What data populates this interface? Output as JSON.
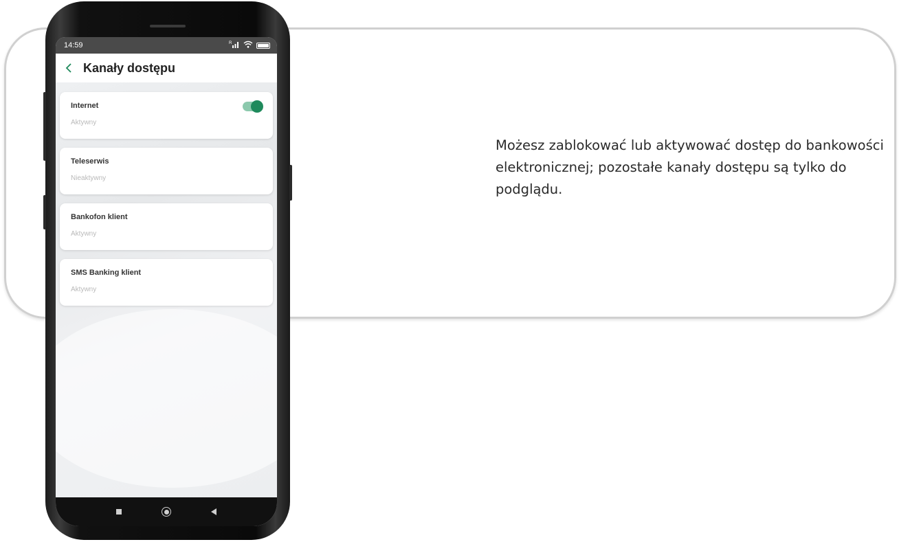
{
  "callout": {
    "text": "Możesz zablokować lub aktywować dostęp do bankowości elektronicznej;  pozostałe kanały dostępu są tylko do podglądu."
  },
  "phone": {
    "statusbar": {
      "time": "14:59",
      "signal_label": "R"
    },
    "appbar": {
      "title": "Kanały dostępu",
      "back_icon": "chevron-left-icon"
    },
    "channels": [
      {
        "name": "Internet",
        "status": "Aktywny",
        "has_toggle": true,
        "toggle_on": true
      },
      {
        "name": "Teleserwis",
        "status": "Nieaktywny",
        "has_toggle": false
      },
      {
        "name": "Bankofon klient",
        "status": "Aktywny",
        "has_toggle": false
      },
      {
        "name": "SMS Banking klient",
        "status": "Aktywny",
        "has_toggle": false
      }
    ],
    "colors": {
      "toggle_track": "#8cc9ad",
      "toggle_knob": "#1f8a5c",
      "statusbar": "#4a4a4a"
    },
    "navbar": [
      "square-icon",
      "circle-icon",
      "back-triangle-icon"
    ]
  }
}
